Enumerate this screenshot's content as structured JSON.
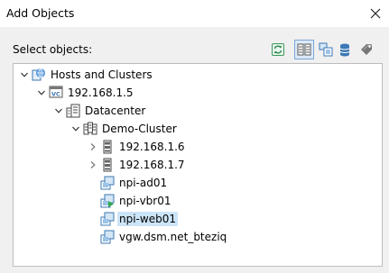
{
  "window": {
    "title": "Add Objects",
    "close_icon": "close-icon"
  },
  "panel": {
    "select_label": "Select objects:"
  },
  "toolbar": [
    {
      "name": "refresh",
      "icon": "refresh-icon",
      "active": false
    },
    {
      "name": "hosts-and-clusters-view",
      "icon": "hosts-clusters-view-icon",
      "active": true
    },
    {
      "name": "vms-and-templates-view",
      "icon": "vms-templates-view-icon",
      "active": false
    },
    {
      "name": "datastores-view",
      "icon": "datastore-icon",
      "active": false
    },
    {
      "name": "tags-view",
      "icon": "tag-icon",
      "active": false
    }
  ],
  "tree": [
    {
      "label": "Hosts and Clusters",
      "icon": "hosts-clusters-icon",
      "level": 0,
      "expander": "expanded",
      "selected": false
    },
    {
      "label": "192.168.1.5",
      "icon": "vcenter-icon",
      "level": 1,
      "expander": "expanded",
      "selected": false
    },
    {
      "label": "Datacenter",
      "icon": "datacenter-icon",
      "level": 2,
      "expander": "expanded",
      "selected": false
    },
    {
      "label": "Demo-Cluster",
      "icon": "cluster-icon",
      "level": 3,
      "expander": "expanded",
      "selected": false
    },
    {
      "label": "192.168.1.6",
      "icon": "host-icon",
      "level": 4,
      "expander": "collapsed",
      "selected": false
    },
    {
      "label": "192.168.1.7",
      "icon": "host-icon",
      "level": 4,
      "expander": "collapsed",
      "selected": false
    },
    {
      "label": "npi-ad01",
      "icon": "vm-icon",
      "level": 4,
      "expander": "none",
      "selected": false
    },
    {
      "label": "npi-vbr01",
      "icon": "vm-running-icon",
      "level": 4,
      "expander": "none",
      "selected": false
    },
    {
      "label": "npi-web01",
      "icon": "vm-icon",
      "level": 4,
      "expander": "none",
      "selected": true
    },
    {
      "label": "vgw.dsm.net_bteziq",
      "icon": "vm-icon",
      "level": 4,
      "expander": "none",
      "selected": false
    }
  ]
}
